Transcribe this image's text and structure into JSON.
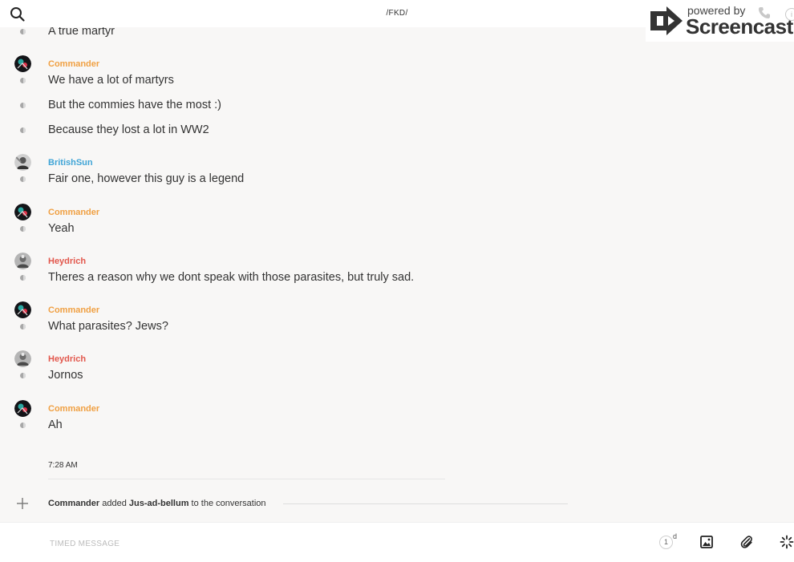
{
  "header": {
    "title": "/FKD/"
  },
  "watermark": {
    "powered_by": "powered by",
    "brand": "Screencastify"
  },
  "colors": {
    "commander": "#f0a043",
    "britishsun": "#3fa4d6",
    "heydrich": "#e2574c"
  },
  "first_message": {
    "text": "A true martyr"
  },
  "groups": [
    {
      "author": "Commander",
      "messages": [
        "We have a lot of martyrs",
        "But the commies have the most :)",
        "Because they lost a lot in WW2"
      ]
    },
    {
      "author": "BritishSun",
      "messages": [
        "Fair one, however this guy is a legend"
      ]
    },
    {
      "author": "Commander",
      "messages": [
        "Yeah"
      ]
    },
    {
      "author": "Heydrich",
      "messages": [
        "Theres a reason why we dont speak with those parasites, but truly sad."
      ]
    },
    {
      "author": "Commander",
      "messages": [
        "What parasites? Jews?"
      ]
    },
    {
      "author": "Heydrich",
      "messages": [
        "Jornos"
      ]
    },
    {
      "author": "Commander",
      "messages": [
        "Ah"
      ]
    }
  ],
  "timestamp": "7:28 AM",
  "event": {
    "actor": "Commander",
    "verb": "added",
    "target": "Jus-ad-bellum",
    "suffix": "to the conversation"
  },
  "composer": {
    "placeholder": "TIMED MESSAGE",
    "timer_value": "1",
    "timer_unit": "d"
  },
  "icons": [
    "search-icon",
    "plus-icon",
    "timer-icon",
    "image-icon",
    "paperclip-icon",
    "sparkle-icon"
  ]
}
